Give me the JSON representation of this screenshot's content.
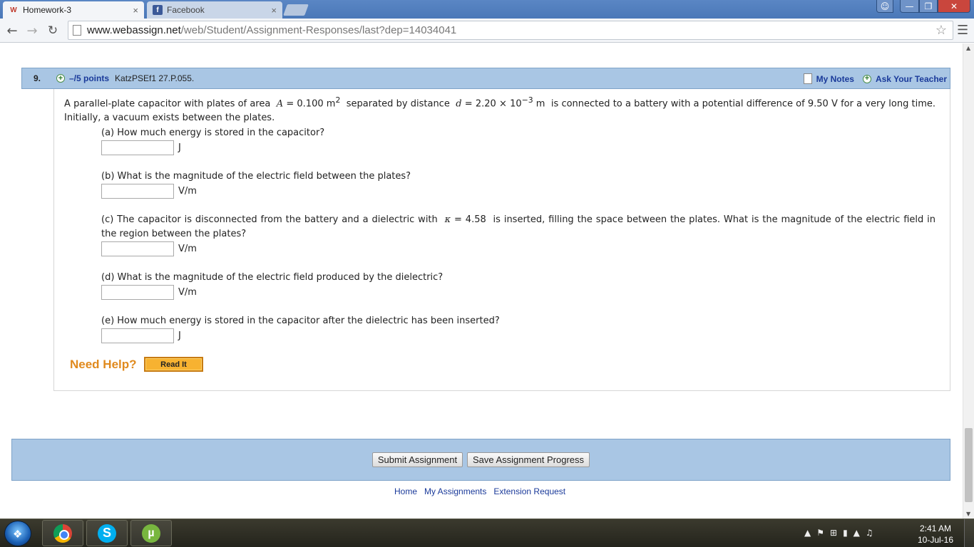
{
  "browser": {
    "tabs": [
      {
        "label": "Homework-3",
        "favicon": "webassign-icon",
        "close": "×"
      },
      {
        "label": "Facebook",
        "favicon": "facebook-icon",
        "close": "×"
      }
    ],
    "url_domain": "www.webassign.net",
    "url_path": "/web/Student/Assignment-Responses/last?dep=14034041"
  },
  "question": {
    "number": "9.",
    "points": "–/5 points",
    "code": "KatzPSEf1 27.P.055.",
    "my_notes": "My Notes",
    "ask_teacher": "Ask Your Teacher",
    "intro_1": "A parallel-plate capacitor with plates of area",
    "var_A": "A",
    "val_A": "= 0.100 m",
    "sup_A": "2",
    "intro_2": "separated by distance",
    "var_d": "d",
    "val_d": "= 2.20 × 10",
    "sup_d": "−3",
    "unit_d": "m",
    "intro_3": "is connected to a battery with a potential difference of 9.50 V for a very long time. Initially, a vacuum exists between the plates.",
    "parts": [
      {
        "label": "(a) How much energy is stored in the capacitor?",
        "unit": "J"
      },
      {
        "label": "(b) What is the magnitude of the electric field between the plates?",
        "unit": "V/m"
      },
      {
        "label_1": "(c) The capacitor is disconnected from the battery and a dielectric with",
        "kappa": "κ",
        "label_2": "= 4.58",
        "label_3": "is inserted, filling the space between the plates. What is the magnitude of the electric field in the region between the plates?",
        "unit": "V/m"
      },
      {
        "label": "(d) What is the magnitude of the electric field produced by the dielectric?",
        "unit": "V/m"
      },
      {
        "label": "(e) How much energy is stored in the capacitor after the dielectric has been inserted?",
        "unit": "J"
      }
    ],
    "need_help": "Need Help?",
    "read_it": "Read It"
  },
  "actions": {
    "submit": "Submit Assignment",
    "save": "Save Assignment Progress"
  },
  "footer": {
    "links": [
      "Home",
      "My Assignments",
      "Extension Request"
    ]
  },
  "taskbar": {
    "time": "2:41 AM",
    "date": "10-Jul-16"
  }
}
